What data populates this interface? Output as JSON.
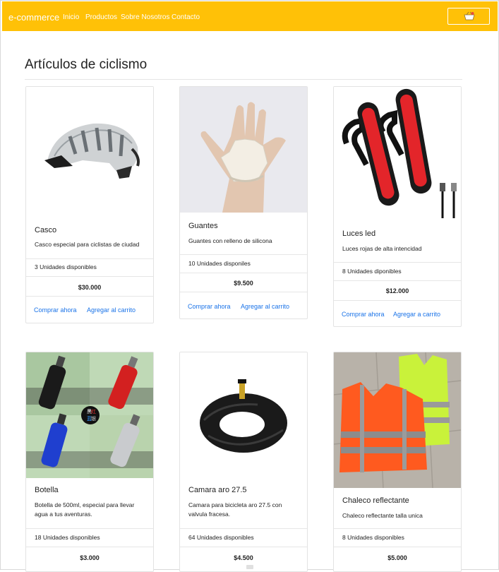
{
  "navbar": {
    "brand": "e-commerce",
    "links": [
      "Inicio",
      "Productos",
      "Sobre Nosotros",
      "Contacto"
    ]
  },
  "section_title": "Artículos de ciclismo",
  "products": [
    {
      "name": "Casco",
      "description": "Casco especial para ciclistas de ciudad",
      "stock": "3 Unidades disponibles",
      "price": "$30.000",
      "buy_label": "Comprar ahora",
      "cart_label": "Agregar al carrito"
    },
    {
      "name": "Guantes",
      "description": "Guantes con relleno de silicona",
      "stock": "10 Unidades disponiles",
      "price": "$9.500",
      "buy_label": "Comprar ahora",
      "cart_label": "Agregar al carrito"
    },
    {
      "name": "Luces led",
      "description": "Luces rojas de alta intencidad",
      "stock": "8 Unidades diponibles",
      "price": "$12.000",
      "buy_label": "Comprar ahora",
      "cart_label": "Agregar a carrito"
    },
    {
      "name": "Botella",
      "description": "Botella de 500ml, especial para llevar agua a tus aventuras.",
      "stock": "18 Unidades disponibles",
      "price": "$3.000"
    },
    {
      "name": "Camara aro 27.5",
      "description": "Camara para bicicleta aro 27.5 con valvula fracesa.",
      "stock": "64 Unidades disponibles",
      "price": "$4.500"
    },
    {
      "name": "Chaleco reflectante",
      "description": "Chaleco reflectante talla unica",
      "stock": "8 Unidades disponibles",
      "price": "$5.000"
    }
  ],
  "colors": {
    "navbar": "#ffc107",
    "link": "#1a73e8"
  }
}
